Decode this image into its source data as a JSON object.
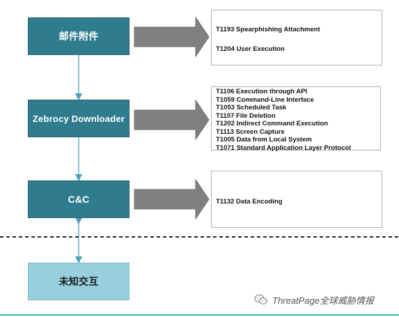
{
  "nodes": {
    "email_attachment": "邮件附件",
    "zebrocy_downloader": "Zebrocy Downloader",
    "cnc": "C&C",
    "unknown_interaction": "未知交互"
  },
  "techniques": {
    "email": [
      "T1193  Spearphishing Attachment",
      "T1204 User Execution"
    ],
    "downloader": [
      "T1106 Execution through API",
      "T1059 Command-Line Interface",
      "T1053 Scheduled Task",
      "T1107 File Deletion",
      "T1202 Indirect Command Execution",
      "T1113 Screen Capture",
      "T1005 Data from Local System",
      "T1071 Standard Application Layer Protocol"
    ],
    "cnc": [
      "T1132 Data Encoding"
    ]
  },
  "watermark": {
    "text": "ThreatPage全球威胁情报",
    "icon": "wechat-icon"
  },
  "colors": {
    "node_dark": "#2f7f92",
    "node_light": "#97d0dd",
    "arrow_gray": "#808080",
    "connector": "#4aa3bf",
    "bottom_line": "#3fb2a0"
  }
}
